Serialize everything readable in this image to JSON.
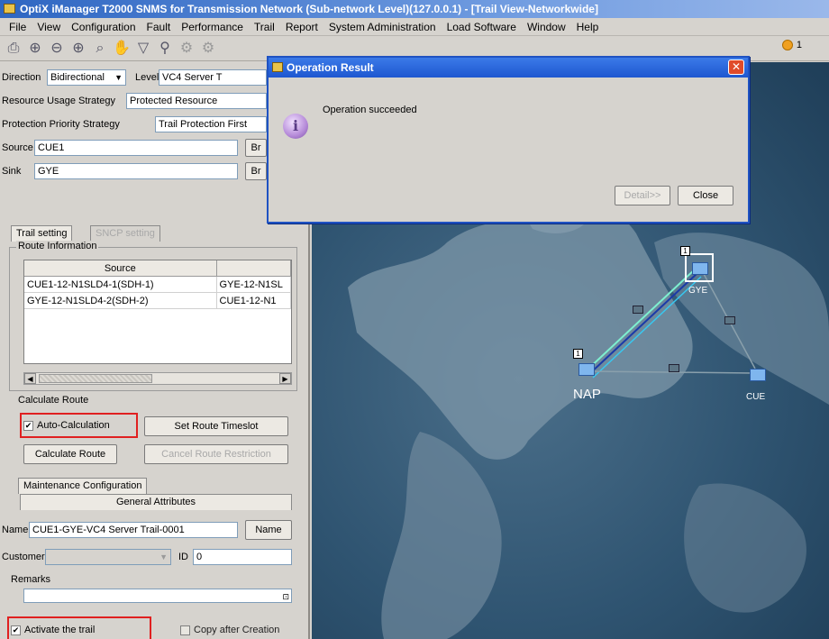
{
  "window": {
    "title": "OptiX iManager T2000 SNMS for Transmission Network (Sub-network Level)(127.0.0.1) - [Trail View-Networkwide]"
  },
  "menu": [
    "File",
    "View",
    "Configuration",
    "Fault",
    "Performance",
    "Trail",
    "Report",
    "System Administration",
    "Load Software",
    "Window",
    "Help"
  ],
  "toolbar": {
    "icons": [
      "print-icon",
      "zoom-in-icon",
      "zoom-out-icon",
      "zoom-fit-icon",
      "zoom-select-icon",
      "pan-hand-icon",
      "filter-icon",
      "binoculars-icon",
      "topology-icon",
      "connection-icon"
    ],
    "alarm_count": "1",
    "alarm_color": "#f0a020"
  },
  "form": {
    "direction_label": "Direction",
    "direction_value": "Bidirectional",
    "level_label": "Level",
    "level_value": "VC4 Server T",
    "resource_usage_label": "Resource Usage Strategy",
    "resource_usage_value": "Protected Resource",
    "protection_priority_label": "Protection Priority Strategy",
    "protection_priority_value": "Trail Protection First",
    "source_label": "Source",
    "source_value": "CUE1",
    "sink_label": "Sink",
    "sink_value": "GYE",
    "browse_label": "Br"
  },
  "tabs": {
    "trail_setting": "Trail setting",
    "sncp_setting": "SNCP setting"
  },
  "route_info": {
    "title": "Route Information",
    "columns": [
      "Source",
      ""
    ],
    "rows": [
      [
        "CUE1-12-N1SLD4-1(SDH-1)",
        "GYE-12-N1SL"
      ],
      [
        "GYE-12-N1SLD4-2(SDH-2)",
        "CUE1-12-N1"
      ]
    ]
  },
  "calculate_route": {
    "title": "Calculate Route",
    "auto_calc_label": "Auto-Calculation",
    "auto_calc_checked": "✔",
    "set_timeslot_label": "Set Route Timeslot",
    "calc_route_label": "Calculate Route",
    "cancel_restriction_label": "Cancel Route Restriction"
  },
  "attributes": {
    "tab_maintenance": "Maintenance Configuration",
    "tab_general": "General Attributes",
    "name_label": "Name",
    "name_value": "CUE1-GYE-VC4 Server Trail-0001",
    "name_button": "Name",
    "customer_label": "Customer",
    "id_label": "ID",
    "id_value": "0",
    "remarks_label": "Remarks"
  },
  "bottom": {
    "activate_label": "Activate the trail",
    "activate_checked": "✔",
    "copy_label": "Copy after Creation"
  },
  "dialog": {
    "title": "Operation Result",
    "message": "Operation succeeded",
    "detail_label": "Detail>>",
    "close_label": "Close"
  },
  "map": {
    "nodes": {
      "gye": "GYE",
      "nap": "NAP",
      "cue": "CUE"
    },
    "link_badge": "1"
  },
  "colors": {
    "highlight_box": "#e02020",
    "dialog_border": "#1f52c2",
    "map_sea": "#2f5471"
  }
}
